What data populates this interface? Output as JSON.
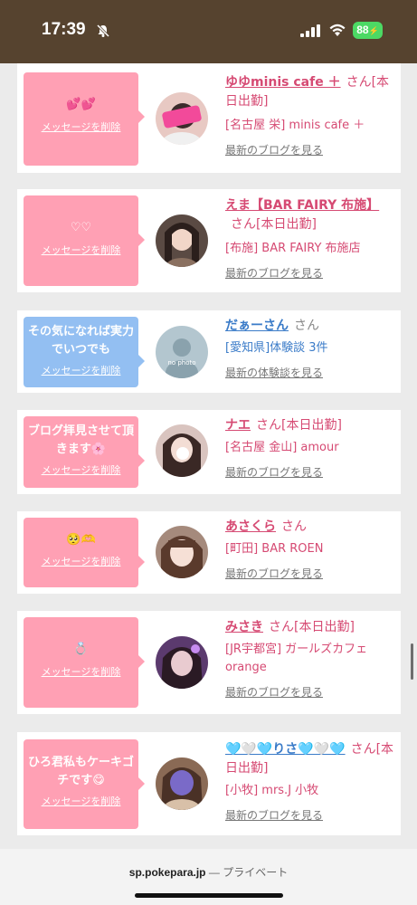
{
  "status_bar": {
    "time": "17:39",
    "battery": "88"
  },
  "bubble_common": {
    "delete_label": "メッセージを削除"
  },
  "cards": [
    {
      "message": "💕💕",
      "name": "ゆゆminis cafe ＋",
      "suffix": "さん[本日出勤]",
      "shop": "[名古屋 栄] minis cafe ＋",
      "link": "最新のブログを見る"
    },
    {
      "message": "♡♡",
      "name": "えま【BAR FAIRY 布施】",
      "suffix": "さん[本日出勤]",
      "shop": "[布施] BAR FAIRY 布施店",
      "link": "最新のブログを見る"
    },
    {
      "message": "その気になれば実力でいつでも",
      "name": "だぁーさん",
      "suffix": "さん",
      "shop": "[愛知県]体験談 3件",
      "link": "最新の体験談を見る",
      "avatar_text": "no photo"
    },
    {
      "message": "ブログ拝見させて頂きます🌸",
      "name": "ナエ",
      "suffix": "さん[本日出勤]",
      "shop": "[名古屋 金山] amour",
      "link": "最新のブログを見る"
    },
    {
      "message": "🥺🫶",
      "name": "あさくら",
      "suffix": "さん",
      "shop": "[町田] BAR ROEN",
      "link": "最新のブログを見る"
    },
    {
      "message": "💍",
      "name": "みさき",
      "suffix": "さん[本日出勤]",
      "shop": "[JR宇都宮] ガールズカフェ orange",
      "link": "最新のブログを見る"
    },
    {
      "message": "ひろ君私もケーキゴチです😋",
      "name": "🩵🤍🩵りさ🩵🤍🩵",
      "suffix": "さん[本日出勤]",
      "shop": "[小牧] mrs.J 小牧",
      "link": "最新のブログを見る"
    }
  ],
  "bottom_bar": {
    "domain": "sp.pokepara.jp",
    "separator": "—",
    "mode": "プライベート"
  },
  "colors": {
    "status_bg": "#56432f",
    "bubble_pink": "#ffa0b4",
    "bubble_blue": "#93bff2",
    "name_pink": "#d64a73",
    "name_blue": "#3a7bc8",
    "battery_green": "#4cd964"
  }
}
